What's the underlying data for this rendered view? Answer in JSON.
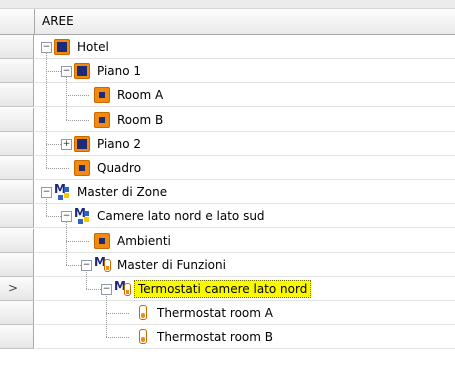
{
  "header": {
    "title": "AREE"
  },
  "selected_row_indicator": ">",
  "tree": [
    {
      "label": "Hotel",
      "icon": "building-icon",
      "expander": "−"
    },
    {
      "label": "Piano 1",
      "icon": "building-icon",
      "expander": "−"
    },
    {
      "label": "Room A",
      "icon": "room-icon",
      "expander": ""
    },
    {
      "label": "Room B",
      "icon": "room-icon",
      "expander": ""
    },
    {
      "label": "Piano 2",
      "icon": "building-icon",
      "expander": "+"
    },
    {
      "label": "Quadro",
      "icon": "room-icon",
      "expander": ""
    },
    {
      "label": "Master di Zone",
      "icon": "master-zone-icon",
      "expander": "−"
    },
    {
      "label": "Camere lato nord e lato sud",
      "icon": "master-zone-icon",
      "expander": "−"
    },
    {
      "label": "Ambienti",
      "icon": "room-icon",
      "expander": ""
    },
    {
      "label": "Master di Funzioni",
      "icon": "master-function-icon",
      "expander": "−"
    },
    {
      "label": "Termostati camere lato nord",
      "icon": "master-function-icon",
      "expander": "−",
      "selected": true
    },
    {
      "label": "Thermostat room A",
      "icon": "thermostat-icon",
      "expander": ""
    },
    {
      "label": "Thermostat room B",
      "icon": "thermostat-icon",
      "expander": ""
    }
  ],
  "colors": {
    "selection": "#fbf900",
    "icon_orange": "#f08a10",
    "icon_navy": "#1c2a78",
    "master_blue": "#2b63c6",
    "master_yellow": "#f6c900"
  }
}
